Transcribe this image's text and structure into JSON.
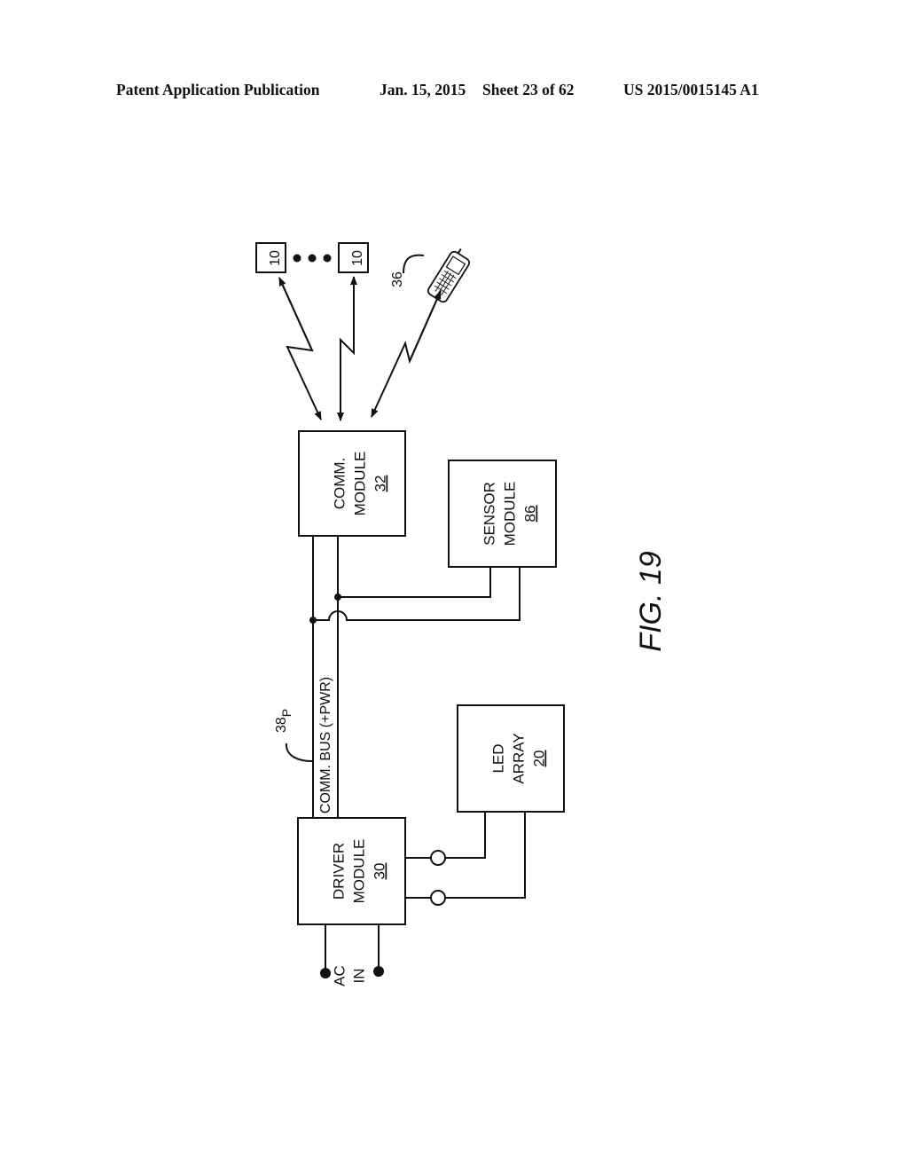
{
  "header": {
    "publication": "Patent Application Publication",
    "date": "Jan. 15, 2015",
    "sheet": "Sheet 23 of 62",
    "number": "US 2015/0015145 A1"
  },
  "figure": {
    "label": "FIG. 19",
    "devices": [
      {
        "ref": "10"
      },
      {
        "ref": "10"
      }
    ],
    "phone_ref": "36",
    "comm_module": {
      "line1": "COMM.",
      "line2": "MODULE",
      "ref": "32"
    },
    "sensor_module": {
      "line1": "SENSOR",
      "line2": "MODULE",
      "ref": "86"
    },
    "driver_module": {
      "line1": "DRIVER",
      "line2": "MODULE",
      "ref": "30"
    },
    "led_array": {
      "line1": "LED",
      "line2": "ARRAY",
      "ref": "20"
    },
    "bus_label": "COMM. BUS (+PWR)",
    "bus_ref": "38",
    "bus_ref_sub": "P",
    "ac_in": {
      "line1": "AC",
      "line2": "IN"
    }
  }
}
